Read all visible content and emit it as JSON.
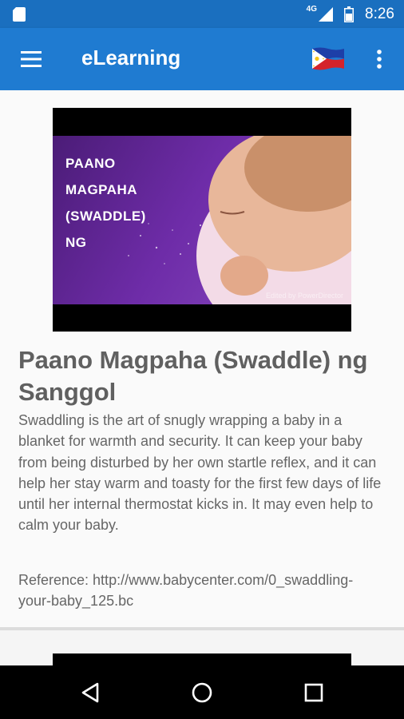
{
  "status_bar": {
    "network": "4G",
    "time": "8:26",
    "icons": [
      "sd-card-icon",
      "signal-icon",
      "battery-icon"
    ]
  },
  "app_bar": {
    "title": "eLearning",
    "icons": [
      "hamburger-menu-icon",
      "philippines-flag-icon",
      "more-vert-icon"
    ]
  },
  "article": {
    "thumbnail_caption": [
      "PAANO",
      "MAGPAHA",
      "(SWADDLE)",
      "NG"
    ],
    "thumbnail_credit": "Edited by PowerDirector",
    "title": "Paano Magpaha (Swaddle) ng Sanggol",
    "description": "Swaddling is the art of snugly wrapping a baby in a blanket for warmth and security. It can keep your baby from being disturbed by her own startle reflex, and it can help her stay warm and toasty for the first few days of life until her internal thermostat kicks in. It may even help to calm your baby.",
    "reference": "Reference: http://www.babycenter.com/0_swaddling-your-baby_125.bc"
  },
  "nav_bar": {
    "icons": [
      "back-icon",
      "home-icon",
      "recents-icon"
    ]
  },
  "colors": {
    "status_bar": "#1a6fbf",
    "app_bar": "#1f7bd1",
    "thumbnail_purple": "#6e2ca8",
    "text": "#666666"
  }
}
